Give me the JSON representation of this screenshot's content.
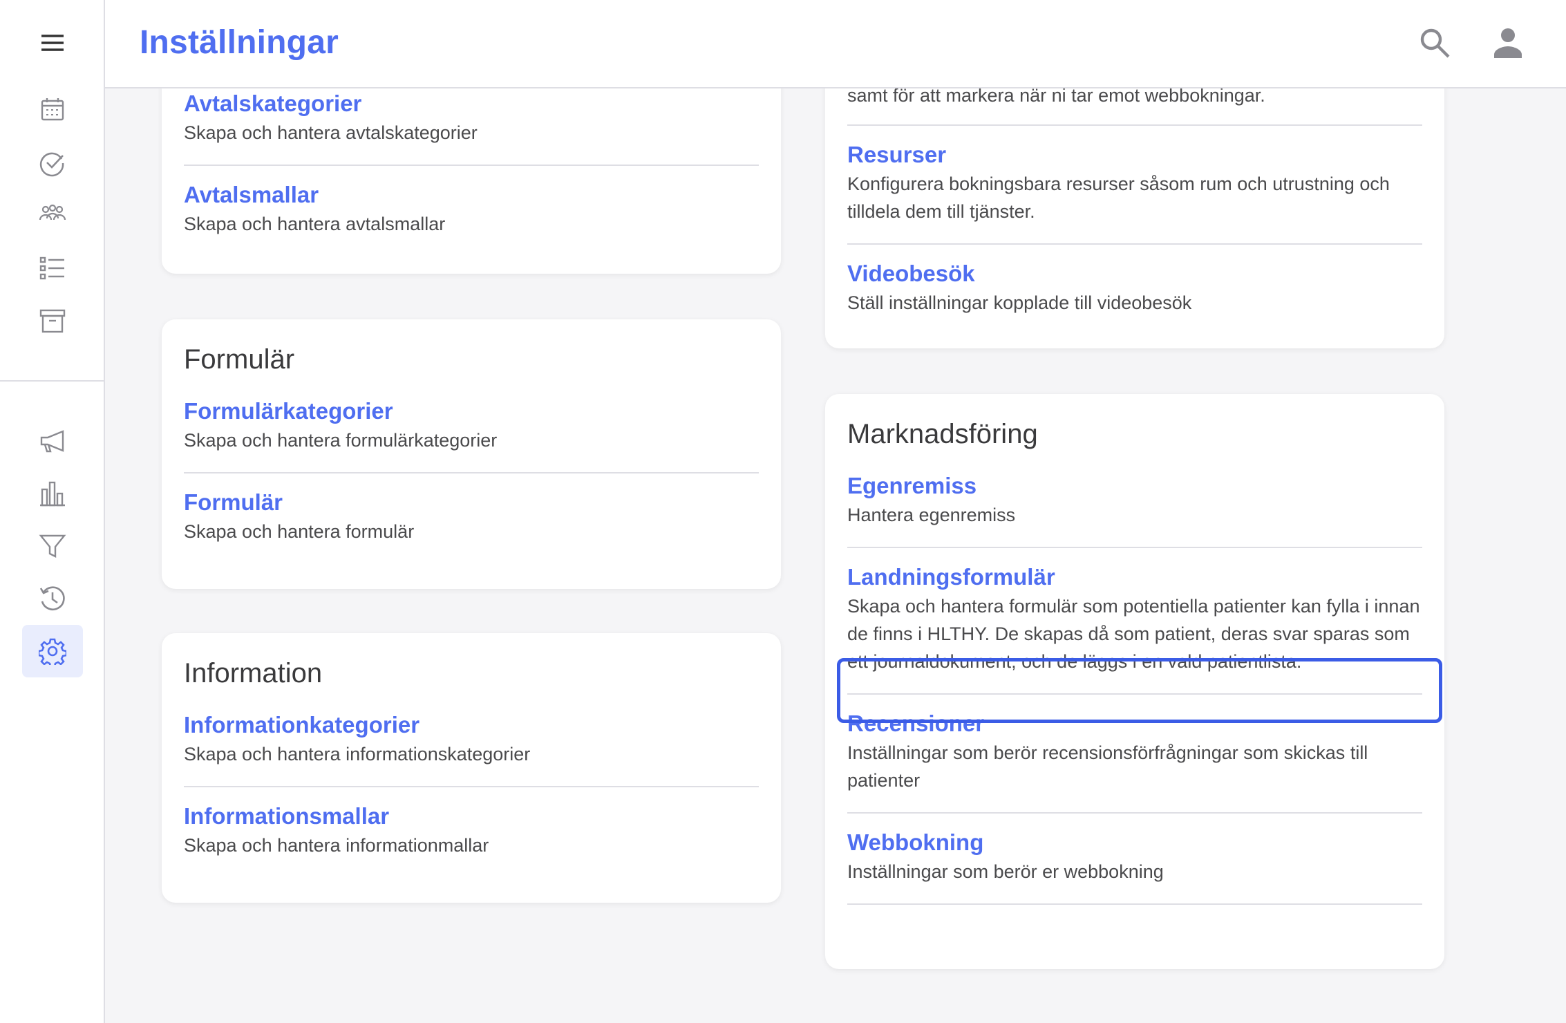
{
  "header": {
    "title": "Inställningar"
  },
  "icons": {
    "menu": "menu-icon",
    "calendar": "calendar-icon",
    "check": "check-circle-icon",
    "users": "users-icon",
    "list": "list-icon",
    "archive": "archive-icon",
    "megaphone": "megaphone-icon",
    "chart": "bar-chart-icon",
    "filter": "filter-icon",
    "history": "history-icon",
    "settings": "settings-icon",
    "search": "search-icon",
    "account": "account-icon"
  },
  "colors": {
    "accent": "#4f6ef0",
    "focus": "#3b5ce6",
    "active_bg": "#e9edfd"
  },
  "left_column": {
    "avtal": {
      "items": [
        {
          "title": "Avtalskategorier",
          "desc": "Skapa och hantera avtalskategorier"
        },
        {
          "title": "Avtalsmallar",
          "desc": "Skapa och hantera avtalsmallar"
        }
      ]
    },
    "formular": {
      "title": "Formulär",
      "items": [
        {
          "title": "Formulärkategorier",
          "desc": "Skapa och hantera formulärkategorier"
        },
        {
          "title": "Formulär",
          "desc": "Skapa och hantera formulär"
        }
      ]
    },
    "information": {
      "title": "Information",
      "items": [
        {
          "title": "Informationkategorier",
          "desc": "Skapa och hantera informationskategorier"
        },
        {
          "title": "Informationsmallar",
          "desc": "Skapa och hantera informationmallar"
        }
      ]
    }
  },
  "right_column": {
    "bokning": {
      "partial_text": "samt för att markera när ni tar emot webbokningar.",
      "items": [
        {
          "title": "Resurser",
          "desc": "Konfigurera bokningsbara resurser såsom rum och utrustning och tilldela dem till tjänster."
        },
        {
          "title": "Videobesök",
          "desc": "Ställ inställningar kopplade till videobesök"
        }
      ]
    },
    "marknadsforing": {
      "title": "Marknadsföring",
      "items": [
        {
          "title": "Egenremiss",
          "desc": "Hantera egenremiss"
        },
        {
          "title": "Landningsformulär",
          "desc": "Skapa och hantera formulär som potentiella patienter kan fylla i innan de finns i HLTHY. De skapas då som patient, deras svar sparas som ett journaldokument, och de läggs i en vald patientlista."
        },
        {
          "title": "Recensioner",
          "desc": "Inställningar som berör recensionsförfrågningar som skickas till patienter"
        },
        {
          "title": "Webbokning",
          "desc": "Inställningar som berör er webbokning"
        }
      ]
    }
  }
}
